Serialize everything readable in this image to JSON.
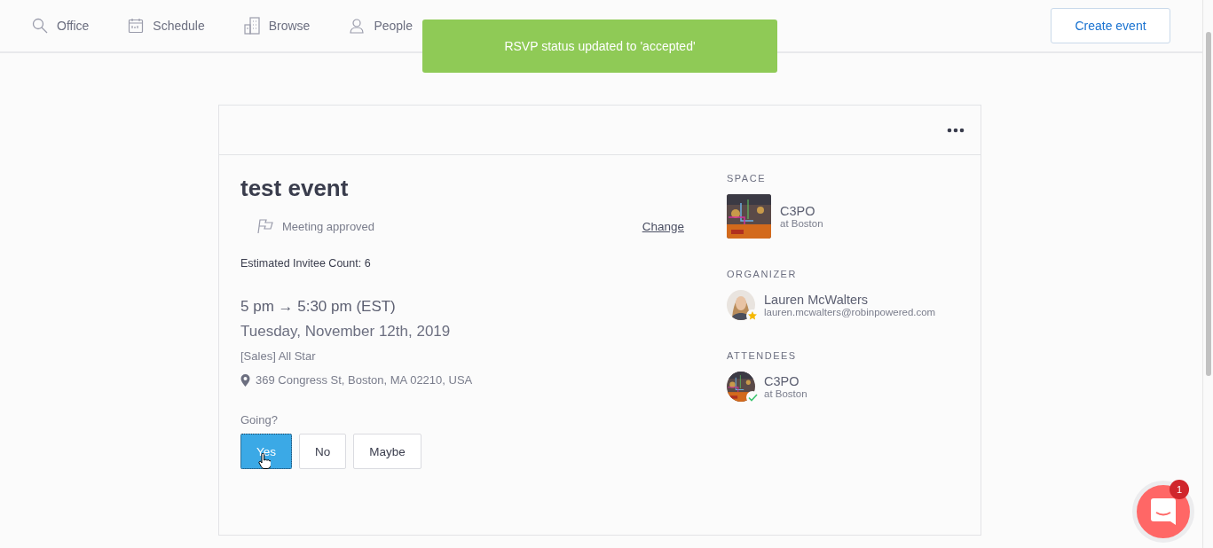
{
  "nav": {
    "items": [
      {
        "label": "Office"
      },
      {
        "label": "Schedule"
      },
      {
        "label": "Browse"
      },
      {
        "label": "People"
      }
    ],
    "action": "Create event"
  },
  "toast": {
    "message": "RSVP status updated to 'accepted'"
  },
  "event": {
    "title": "test event",
    "status": "Meeting approved",
    "change_link": "Change",
    "invitee_count": "Estimated Invitee Count: 6",
    "time": "5 pm → 5:30 pm (EST)",
    "date": "Tuesday, November 12th, 2019",
    "calendar": "[Sales] All Star",
    "address": "369 Congress St, Boston, MA 02210, USA",
    "rsvp": {
      "label": "Going?",
      "options": [
        {
          "label": "Yes",
          "selected": true
        },
        {
          "label": "No",
          "selected": false
        },
        {
          "label": "Maybe",
          "selected": false
        }
      ]
    }
  },
  "sidebar": {
    "sections": [
      {
        "heading": "SPACE",
        "items": [
          {
            "kind": "space",
            "name": "C3PO",
            "detail": "at Boston"
          }
        ]
      },
      {
        "heading": "ORGANIZER",
        "items": [
          {
            "kind": "organizer",
            "name": "Lauren McWalters",
            "detail": "lauren.mcwalters@robinpowered.com"
          }
        ]
      },
      {
        "heading": "ATTENDEES",
        "items": [
          {
            "kind": "attendee",
            "name": "C3PO",
            "detail": "at Boston"
          }
        ]
      }
    ]
  },
  "chat": {
    "count": "1"
  }
}
